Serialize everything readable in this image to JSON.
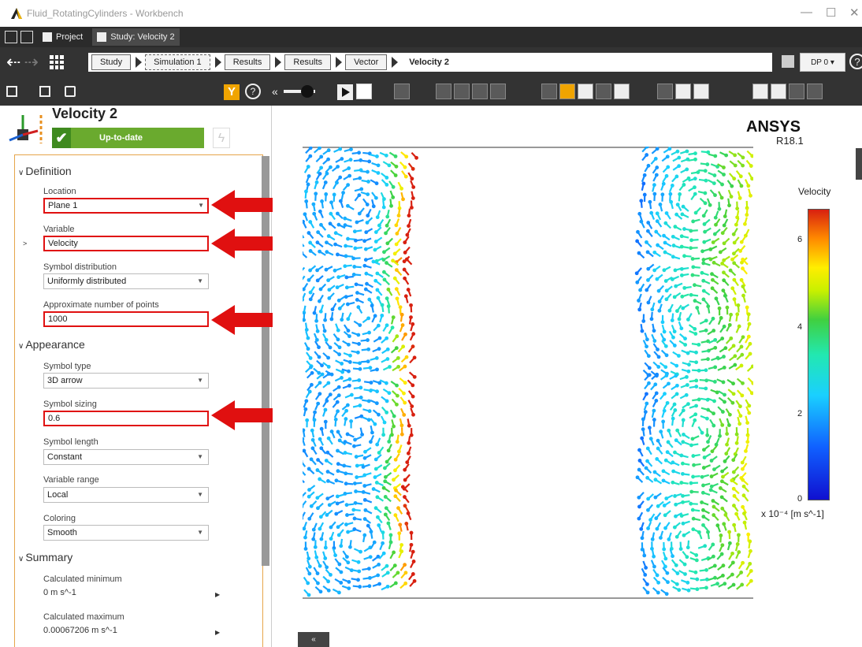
{
  "window": {
    "title": "Fluid_RotatingCylinders - Workbench",
    "controls": [
      "—",
      "☐",
      "✕"
    ]
  },
  "tabs": [
    {
      "label": "Project"
    },
    {
      "label": "Study: Velocity 2"
    }
  ],
  "breadcrumb": {
    "items": [
      "Study",
      "Simulation 1",
      "Results",
      "Results",
      "Vector"
    ],
    "current": "Velocity 2",
    "dp_label": "DP 0 ▾",
    "help": "?"
  },
  "toolbar": {
    "filter": "Y",
    "help": "?",
    "collapse": "«"
  },
  "object": {
    "title": "Velocity 2",
    "status": "Up-to-date",
    "status_check": "✔",
    "lightning": "ϟ"
  },
  "definition": {
    "header": "Definition",
    "location_label": "Location",
    "location_value": "Plane 1",
    "variable_label": "Variable",
    "variable_value": "Velocity",
    "distribution_label": "Symbol distribution",
    "distribution_value": "Uniformly distributed",
    "points_label": "Approximate number of points",
    "points_value": "1000"
  },
  "appearance": {
    "header": "Appearance",
    "symbol_type_label": "Symbol type",
    "symbol_type_value": "3D arrow",
    "symbol_sizing_label": "Symbol sizing",
    "symbol_sizing_value": "0.6",
    "symbol_length_label": "Symbol length",
    "symbol_length_value": "Constant",
    "variable_range_label": "Variable range",
    "variable_range_value": "Local",
    "coloring_label": "Coloring",
    "coloring_value": "Smooth"
  },
  "summary": {
    "header": "Summary",
    "min_label": "Calculated minimum",
    "min_value": "0 m s^-1",
    "max_label": "Calculated maximum",
    "max_value": "0.00067206 m s^-1"
  },
  "viewport": {
    "brand": "ANSYS",
    "version": "R18.1",
    "legend_title": "Velocity",
    "legend_ticks": [
      "6",
      "4",
      "2",
      "0"
    ],
    "legend_unit": "x 10⁻⁴ [m s^-1]",
    "expand_button": "«"
  },
  "colors": {
    "highlight": "#e01010",
    "status_green": "#6aaa2e",
    "filter_orange": "#f0a400"
  }
}
